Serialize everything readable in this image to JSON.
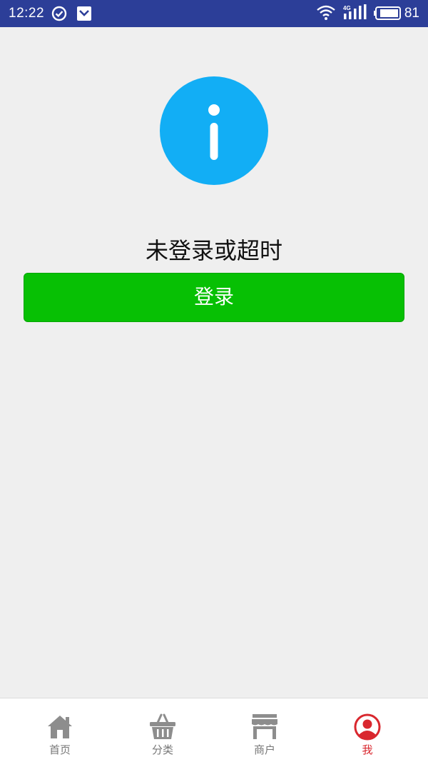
{
  "status_bar": {
    "time": "12:22",
    "battery": "81",
    "network": "4G",
    "background_color": "#2c3e98"
  },
  "main": {
    "info_icon": "info-icon",
    "info_color": "#12aef5",
    "message": "未登录或超时",
    "login_label": "登录",
    "login_color": "#07c004"
  },
  "tab_bar": {
    "active_color": "#d9272e",
    "inactive_color": "#777777",
    "tabs": [
      {
        "label": "首页",
        "icon": "home-icon",
        "active": false
      },
      {
        "label": "分类",
        "icon": "basket-icon",
        "active": false
      },
      {
        "label": "商户",
        "icon": "store-icon",
        "active": false
      },
      {
        "label": "我",
        "icon": "user-icon",
        "active": true
      }
    ]
  }
}
